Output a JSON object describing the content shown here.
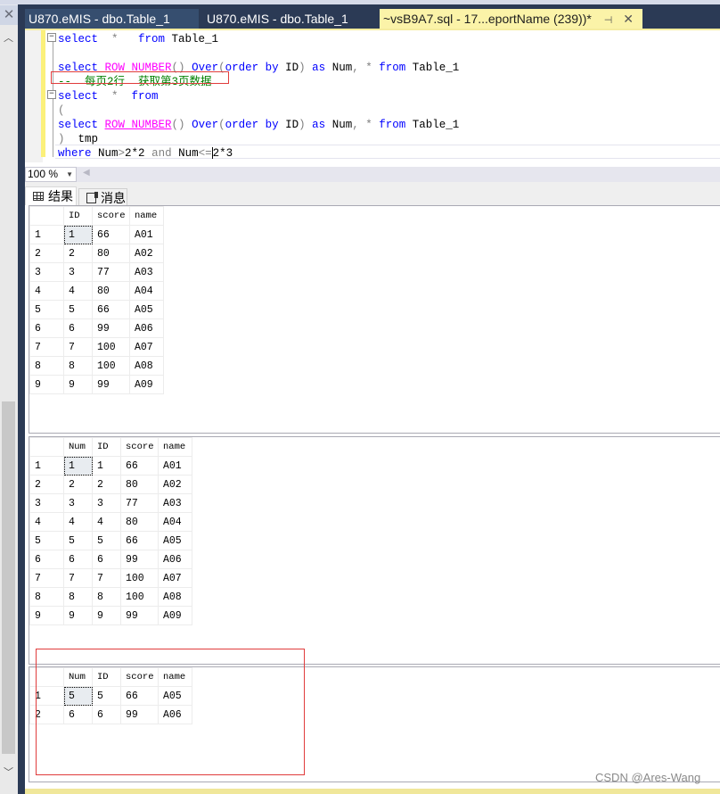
{
  "tabs": [
    {
      "label": "U870.eMIS - dbo.Table_1",
      "active": false
    },
    {
      "label": "U870.eMIS - dbo.Table_1",
      "active": false
    },
    {
      "label": "~vsB9A7.sql - 17...eportName (239))*",
      "active": true
    }
  ],
  "tab_icons": {
    "pin": "pin-icon",
    "close": "close-icon"
  },
  "editor": {
    "lines": [
      {
        "tokens": [
          {
            "t": "select",
            "c": "kw"
          },
          {
            "t": "  *   ",
            "c": "gray"
          },
          {
            "t": "from",
            "c": "kw"
          },
          {
            "t": " Table_1",
            "c": ""
          }
        ]
      },
      {
        "tokens": []
      },
      {
        "tokens": [
          {
            "t": "select",
            "c": "kw"
          },
          {
            "t": " ",
            "c": ""
          },
          {
            "t": "ROW_NUMBER",
            "c": "fn"
          },
          {
            "t": "()",
            "c": "gray"
          },
          {
            "t": " ",
            "c": ""
          },
          {
            "t": "Over",
            "c": "kw"
          },
          {
            "t": "(",
            "c": "gray"
          },
          {
            "t": "order by",
            "c": "kw"
          },
          {
            "t": " ID",
            "c": ""
          },
          {
            "t": ")",
            "c": "gray"
          },
          {
            "t": " ",
            "c": ""
          },
          {
            "t": "as",
            "c": "kw"
          },
          {
            "t": " Num",
            "c": ""
          },
          {
            "t": ", * ",
            "c": "gray"
          },
          {
            "t": "from",
            "c": "kw"
          },
          {
            "t": " Table_1",
            "c": ""
          }
        ]
      },
      {
        "tokens": [
          {
            "t": "--  每页2行  获取第3页数据",
            "c": "cm"
          }
        ]
      },
      {
        "tokens": [
          {
            "t": "select",
            "c": "kw"
          },
          {
            "t": "  *  ",
            "c": "gray"
          },
          {
            "t": "from",
            "c": "kw"
          }
        ]
      },
      {
        "tokens": [
          {
            "t": "(",
            "c": "gray"
          }
        ]
      },
      {
        "tokens": [
          {
            "t": "select",
            "c": "kw"
          },
          {
            "t": " ",
            "c": ""
          },
          {
            "t": "ROW_NUMBER",
            "c": "fn"
          },
          {
            "t": "()",
            "c": "gray"
          },
          {
            "t": " ",
            "c": ""
          },
          {
            "t": "Over",
            "c": "kw"
          },
          {
            "t": "(",
            "c": "gray"
          },
          {
            "t": "order by",
            "c": "kw"
          },
          {
            "t": " ID",
            "c": ""
          },
          {
            "t": ")",
            "c": "gray"
          },
          {
            "t": " ",
            "c": ""
          },
          {
            "t": "as",
            "c": "kw"
          },
          {
            "t": " Num",
            "c": ""
          },
          {
            "t": ", * ",
            "c": "gray"
          },
          {
            "t": "from",
            "c": "kw"
          },
          {
            "t": " Table_1",
            "c": ""
          }
        ]
      },
      {
        "tokens": [
          {
            "t": ")",
            "c": "gray"
          },
          {
            "t": "  tmp",
            "c": ""
          }
        ]
      },
      {
        "tokens": [
          {
            "t": "where",
            "c": "kw"
          },
          {
            "t": " Num",
            "c": ""
          },
          {
            "t": ">",
            "c": "gray"
          },
          {
            "t": "2*2 ",
            "c": ""
          },
          {
            "t": "and",
            "c": "gray"
          },
          {
            "t": " Num",
            "c": ""
          },
          {
            "t": "<=",
            "c": "gray"
          },
          {
            "t": "|CARET|",
            "c": "caret"
          },
          {
            "t": "2*3",
            "c": ""
          }
        ]
      }
    ]
  },
  "zoom": {
    "value": "100 %"
  },
  "result_tabs": {
    "results": "结果",
    "messages": "消息"
  },
  "results": [
    {
      "columns": [
        "ID",
        "score",
        "name"
      ],
      "rows": [
        [
          "1",
          "66",
          "A01"
        ],
        [
          "2",
          "80",
          "A02"
        ],
        [
          "3",
          "77",
          "A03"
        ],
        [
          "4",
          "80",
          "A04"
        ],
        [
          "5",
          "66",
          "A05"
        ],
        [
          "6",
          "99",
          "A06"
        ],
        [
          "7",
          "100",
          "A07"
        ],
        [
          "8",
          "100",
          "A08"
        ],
        [
          "9",
          "99",
          "A09"
        ]
      ]
    },
    {
      "columns": [
        "Num",
        "ID",
        "score",
        "name"
      ],
      "rows": [
        [
          "1",
          "1",
          "66",
          "A01"
        ],
        [
          "2",
          "2",
          "80",
          "A02"
        ],
        [
          "3",
          "3",
          "77",
          "A03"
        ],
        [
          "4",
          "4",
          "80",
          "A04"
        ],
        [
          "5",
          "5",
          "66",
          "A05"
        ],
        [
          "6",
          "6",
          "99",
          "A06"
        ],
        [
          "7",
          "7",
          "100",
          "A07"
        ],
        [
          "8",
          "8",
          "100",
          "A08"
        ],
        [
          "9",
          "9",
          "99",
          "A09"
        ]
      ]
    },
    {
      "columns": [
        "Num",
        "ID",
        "score",
        "name"
      ],
      "rows": [
        [
          "5",
          "5",
          "66",
          "A05"
        ],
        [
          "6",
          "6",
          "99",
          "A06"
        ]
      ]
    }
  ],
  "watermark": "CSDN @Ares-Wang",
  "colors": {
    "active_tab": "#fbf3a8",
    "tabbar": "#2b3a55",
    "annotation": "#e03c3c"
  }
}
